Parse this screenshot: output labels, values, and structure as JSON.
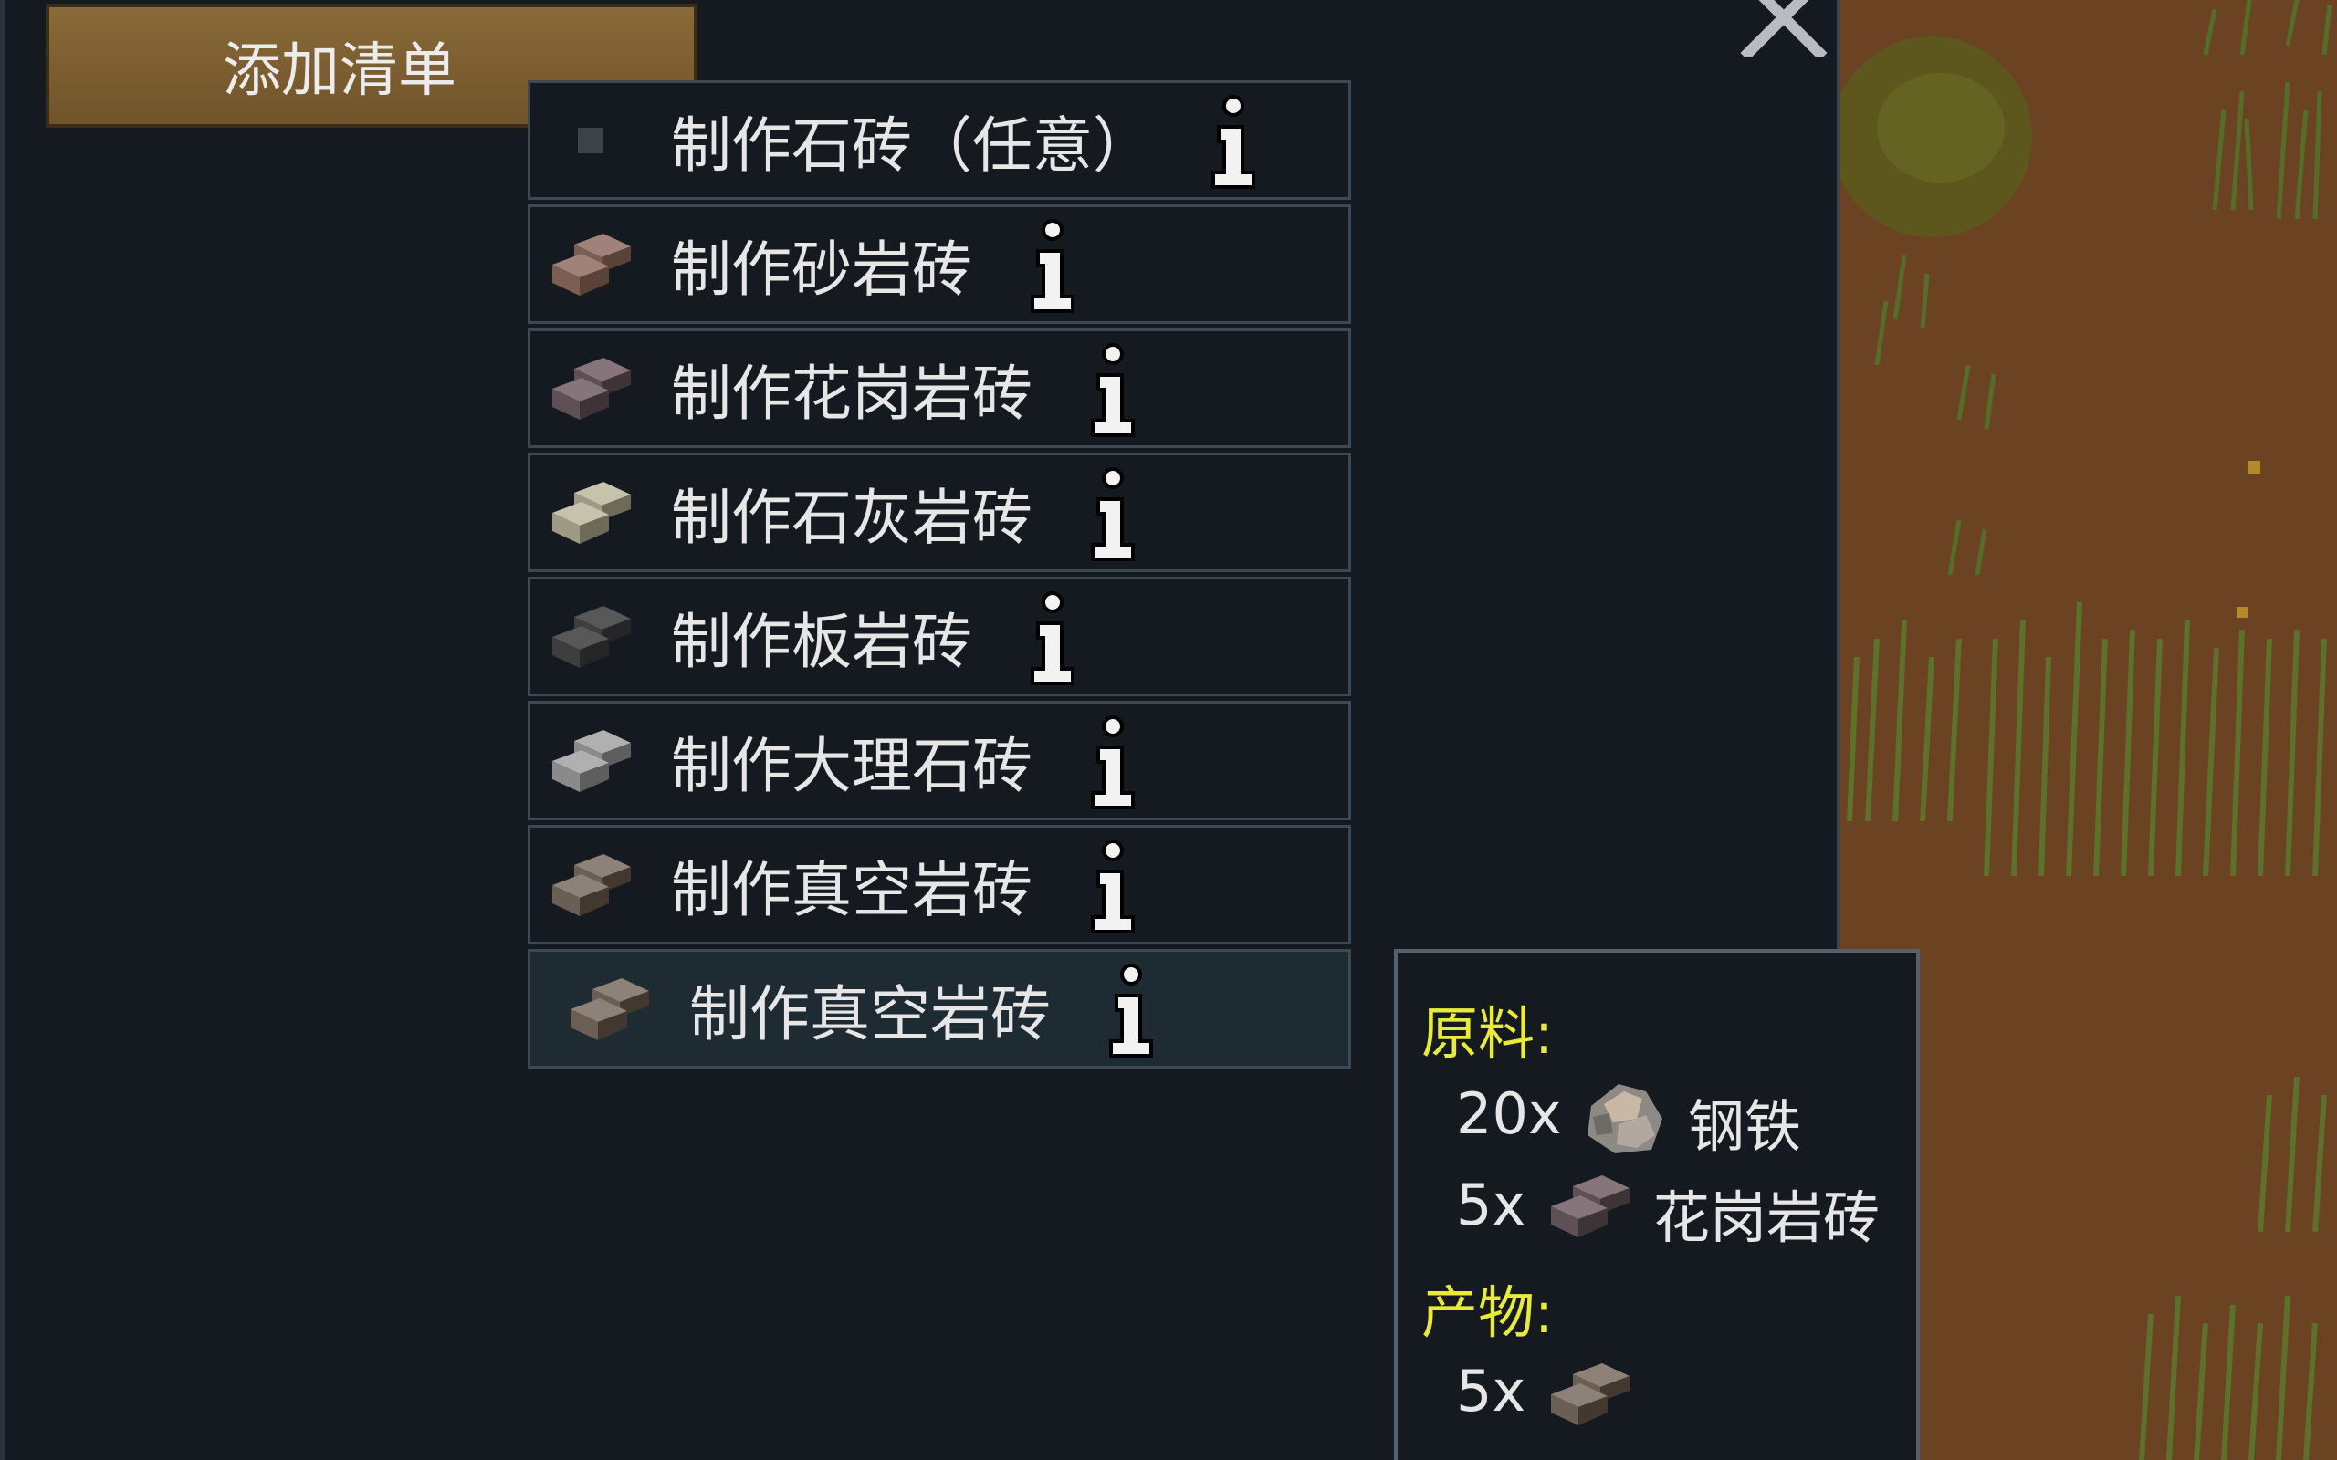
{
  "header": {
    "add_bill_label": "添加清单"
  },
  "menu": {
    "items": [
      {
        "label": "制作石砖（任意）",
        "icon": "small-square-icon",
        "color": "#3d434b"
      },
      {
        "label": "制作砂岩砖",
        "icon": "brick-icon",
        "color": "#7a5e52"
      },
      {
        "label": "制作花岗岩砖",
        "icon": "brick-icon",
        "color": "#5e5055"
      },
      {
        "label": "制作石灰岩砖",
        "icon": "brick-icon",
        "color": "#9e9a86"
      },
      {
        "label": "制作板岩砖",
        "icon": "brick-icon",
        "color": "#3e3e40"
      },
      {
        "label": "制作大理石砖",
        "icon": "brick-icon",
        "color": "#8a8a8a"
      },
      {
        "label": "制作真空岩砖",
        "icon": "brick-icon",
        "color": "#6a5e55"
      },
      {
        "label": "制作真空岩砖",
        "icon": "brick-icon",
        "color": "#6a5e55"
      }
    ]
  },
  "tooltip": {
    "ingredients_header": "原料:",
    "ingredients": [
      {
        "qty": "20x",
        "name": "钢铁",
        "icon": "steel-icon"
      },
      {
        "qty": "5x",
        "name": "花岗岩砖",
        "icon": "brick-icon"
      }
    ],
    "products_header": "产物:",
    "products": [
      {
        "qty": "5x",
        "icon": "brick-icon"
      }
    ]
  },
  "colors": {
    "accent_header": "#eaea3a",
    "button_brown": "#7a5d32",
    "panel": "#151a20"
  }
}
